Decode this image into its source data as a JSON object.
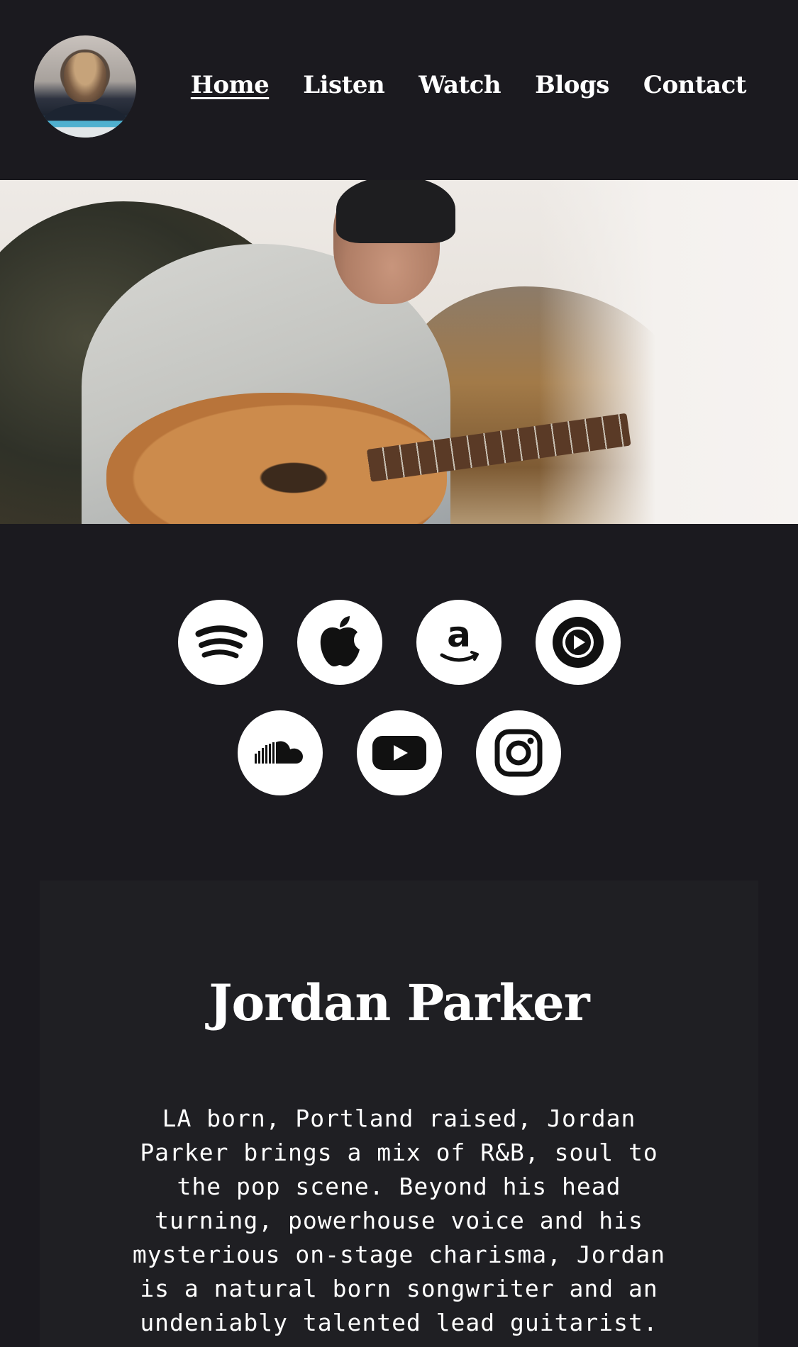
{
  "header": {
    "nav": [
      {
        "label": "Home",
        "active": true
      },
      {
        "label": "Listen",
        "active": false
      },
      {
        "label": "Watch",
        "active": false
      },
      {
        "label": "Blogs",
        "active": false
      },
      {
        "label": "Contact",
        "active": false
      }
    ]
  },
  "socials": {
    "row1": [
      "spotify-icon",
      "apple-music-icon",
      "amazon-music-icon",
      "youtube-music-icon"
    ],
    "row2": [
      "soundcloud-icon",
      "youtube-icon",
      "instagram-icon"
    ]
  },
  "about": {
    "title": "Jordan Parker",
    "bio": "LA born, Portland raised, Jordan Parker brings a mix of R&B, soul to the pop scene. Beyond his head turning, powerhouse voice and his mysterious on-stage charisma, Jordan is a natural born songwriter and an undeniably talented lead guitarist."
  },
  "colors": {
    "background": "#1b1a1f",
    "card": "#1f1f23",
    "text": "#ffffff"
  }
}
